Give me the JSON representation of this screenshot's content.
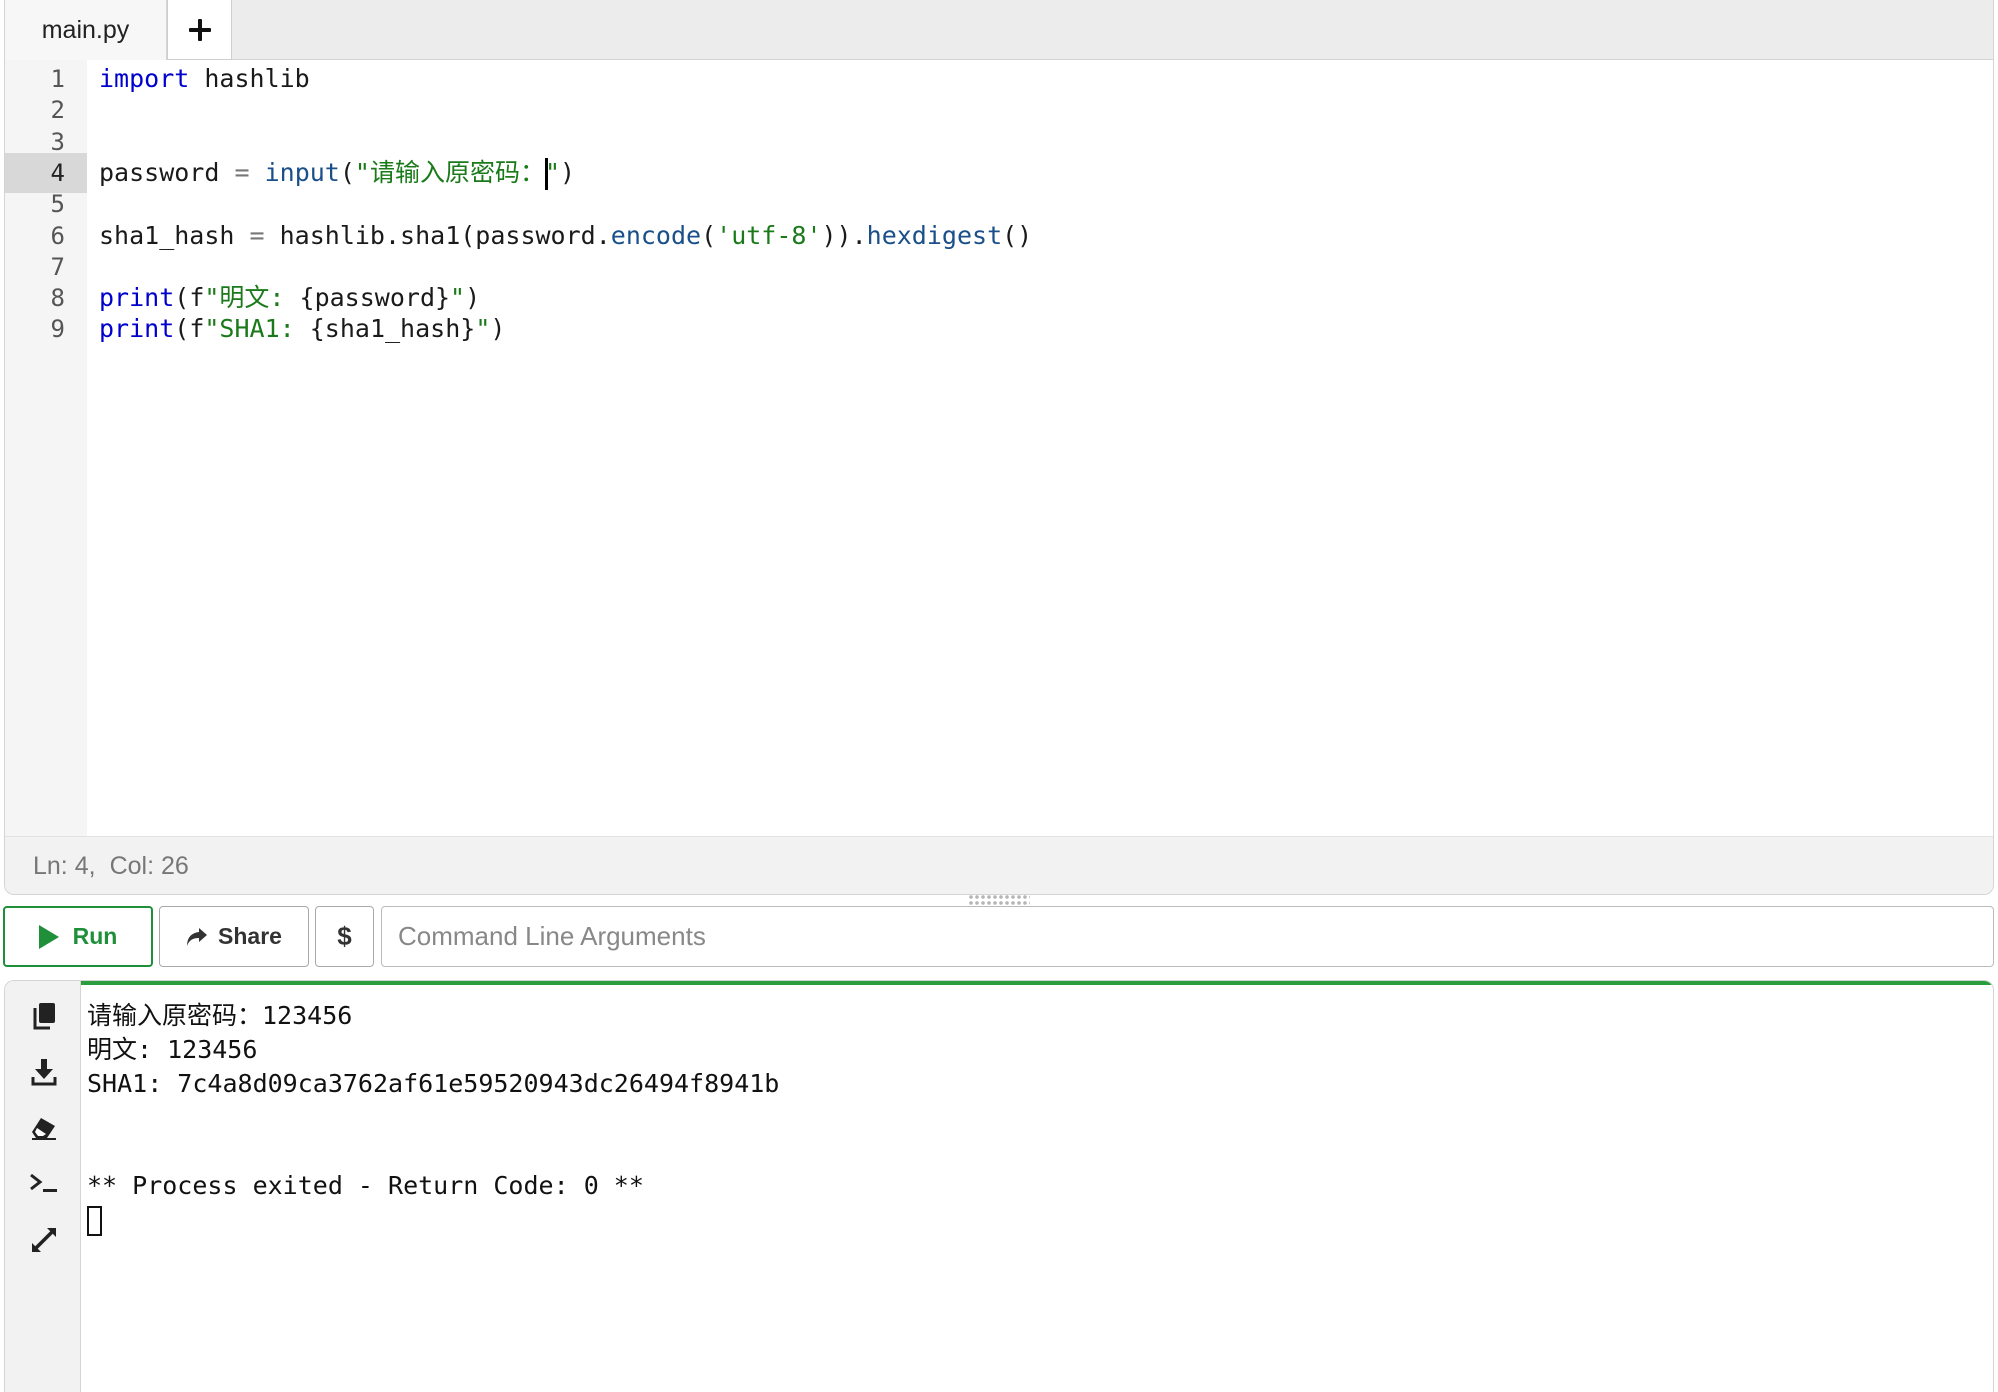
{
  "tabs": {
    "file_label": "main.py",
    "add_label": "+"
  },
  "editor": {
    "line_numbers": [
      "1",
      "2",
      "3",
      "4",
      "5",
      "6",
      "7",
      "8",
      "9"
    ],
    "active_line": 4,
    "lines": [
      [
        {
          "t": "import",
          "c": "kw"
        },
        {
          "t": " hashlib",
          "c": ""
        }
      ],
      [],
      [],
      [
        {
          "t": "password ",
          "c": ""
        },
        {
          "t": "=",
          "c": "op"
        },
        {
          "t": " ",
          "c": ""
        },
        {
          "t": "input",
          "c": "fn"
        },
        {
          "t": "(",
          "c": ""
        },
        {
          "t": "\"请输入原密码：",
          "c": "str"
        },
        {
          "t": "",
          "c": "cursor"
        },
        {
          "t": "\"",
          "c": "str"
        },
        {
          "t": ")",
          "c": ""
        }
      ],
      [],
      [
        {
          "t": "sha1_hash ",
          "c": ""
        },
        {
          "t": "=",
          "c": "op"
        },
        {
          "t": " hashlib.sha1(password.",
          "c": ""
        },
        {
          "t": "encode",
          "c": "fn"
        },
        {
          "t": "(",
          "c": ""
        },
        {
          "t": "'utf-8'",
          "c": "str"
        },
        {
          "t": ")).",
          "c": ""
        },
        {
          "t": "hexdigest",
          "c": "fn"
        },
        {
          "t": "()",
          "c": ""
        }
      ],
      [],
      [
        {
          "t": "print",
          "c": "kw"
        },
        {
          "t": "(f",
          "c": ""
        },
        {
          "t": "\"明文: ",
          "c": "str"
        },
        {
          "t": "{password}",
          "c": ""
        },
        {
          "t": "\"",
          "c": "str"
        },
        {
          "t": ")",
          "c": ""
        }
      ],
      [
        {
          "t": "print",
          "c": "kw"
        },
        {
          "t": "(f",
          "c": ""
        },
        {
          "t": "\"SHA1: ",
          "c": "str"
        },
        {
          "t": "{sha1_hash}",
          "c": ""
        },
        {
          "t": "\"",
          "c": "str"
        },
        {
          "t": ")",
          "c": ""
        }
      ]
    ]
  },
  "status": {
    "line": "Ln: 4,",
    "col": "Col: 26"
  },
  "toolbar": {
    "run_label": "Run",
    "share_label": "Share",
    "dollar_label": "$",
    "args_placeholder": "Command Line Arguments"
  },
  "output": {
    "lines": [
      "请输入原密码：123456",
      "明文: 123456",
      "SHA1: 7c4a8d09ca3762af61e59520943dc26494f8941b",
      "",
      "",
      "** Process exited - Return Code: 0 **"
    ]
  },
  "icons": {
    "copy": "copy-icon",
    "download": "download-icon",
    "eraser": "eraser-icon",
    "terminal": "terminal-icon",
    "expand": "expand-icon",
    "play": "play-icon",
    "share": "share-arrow-icon",
    "plus": "plus-icon"
  },
  "colors": {
    "run_green": "#1f8f3a",
    "keyword": "#0000cc",
    "function": "#1a4f8a",
    "string": "#1a7a1a",
    "active_line_bg": "#d8d8d8"
  }
}
